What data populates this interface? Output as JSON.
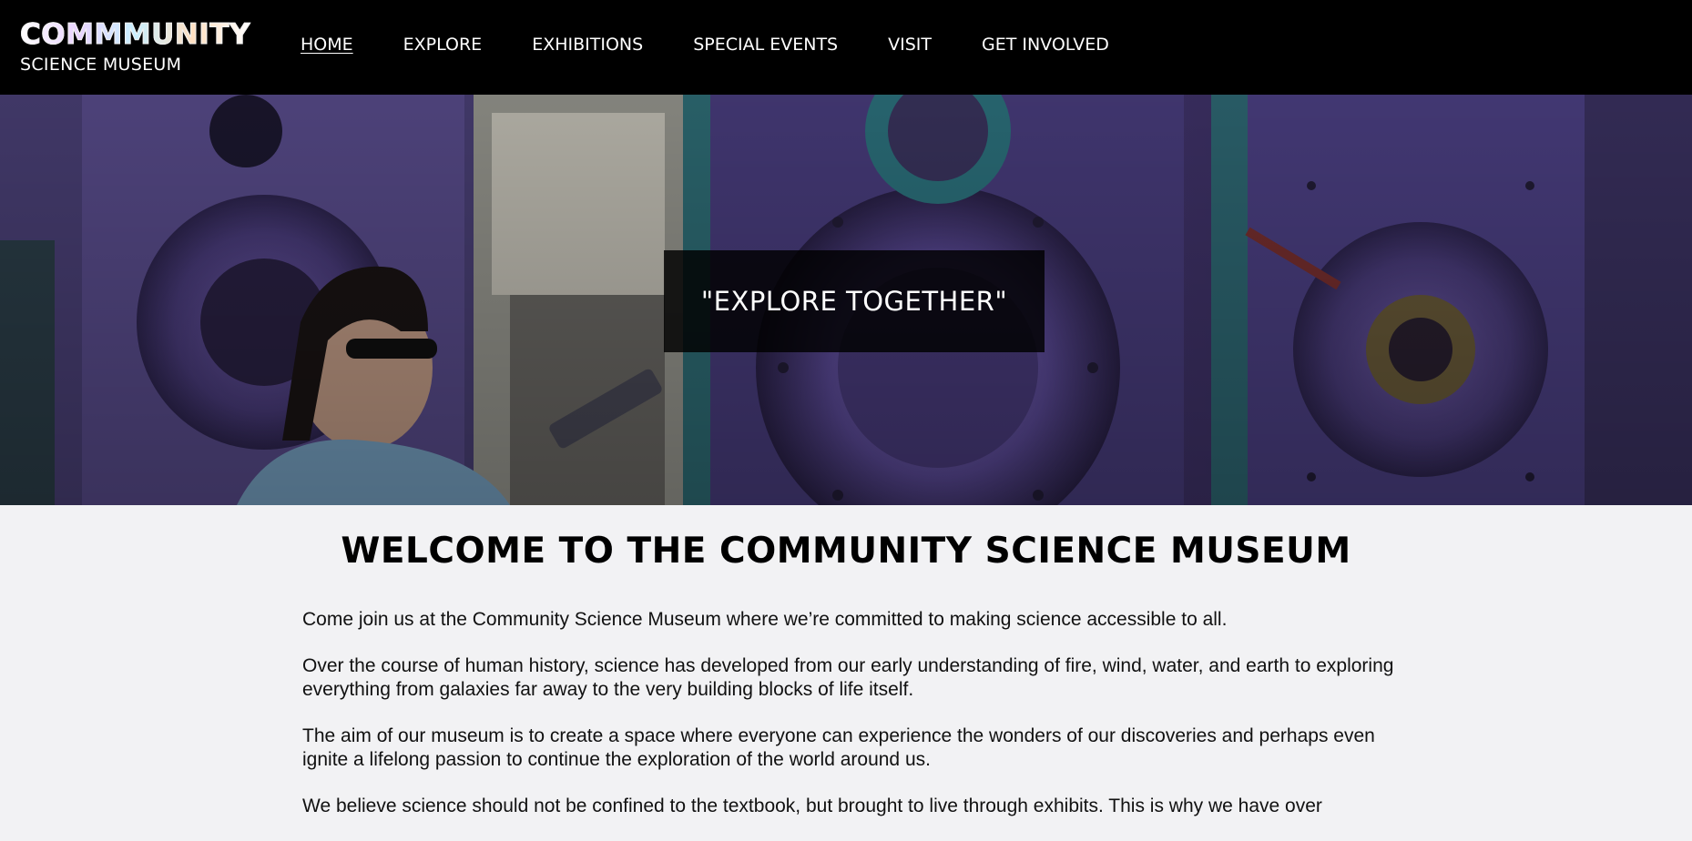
{
  "header": {
    "logo_main": "COMMMUNITY",
    "logo_sub": "SCIENCE MUSEUM",
    "nav": [
      {
        "label": "HOME",
        "active": true
      },
      {
        "label": "EXPLORE"
      },
      {
        "label": "EXHIBITIONS"
      },
      {
        "label": "SPECIAL EVENTS"
      },
      {
        "label": "VISIT"
      },
      {
        "label": "GET INVOLVED"
      }
    ]
  },
  "hero": {
    "quote": "\"EXPLORE TOGETHER\""
  },
  "main": {
    "title": "WELCOME TO THE COMMUNITY SCIENCE MUSEUM",
    "paragraphs": [
      "Come join us at the Community Science Museum where we’re committed to making science accessible to all.",
      "Over the course of human history, science has developed from our early understanding of fire, wind, water, and earth to exploring everything from galaxies far away to the very building blocks of life itself.",
      "The aim of our museum is to create a space where everyone can experience the wonders of our discoveries and perhaps even ignite a lifelong passion to continue the exploration of the world around us.",
      "We believe science should not be confined to the textbook, but brought to live through exhibits. This is why we have over"
    ]
  },
  "colors": {
    "header_bg": "#000000",
    "page_bg": "#f2f2f4",
    "hero_tint": "#5b3f8f",
    "text": "#111111"
  }
}
